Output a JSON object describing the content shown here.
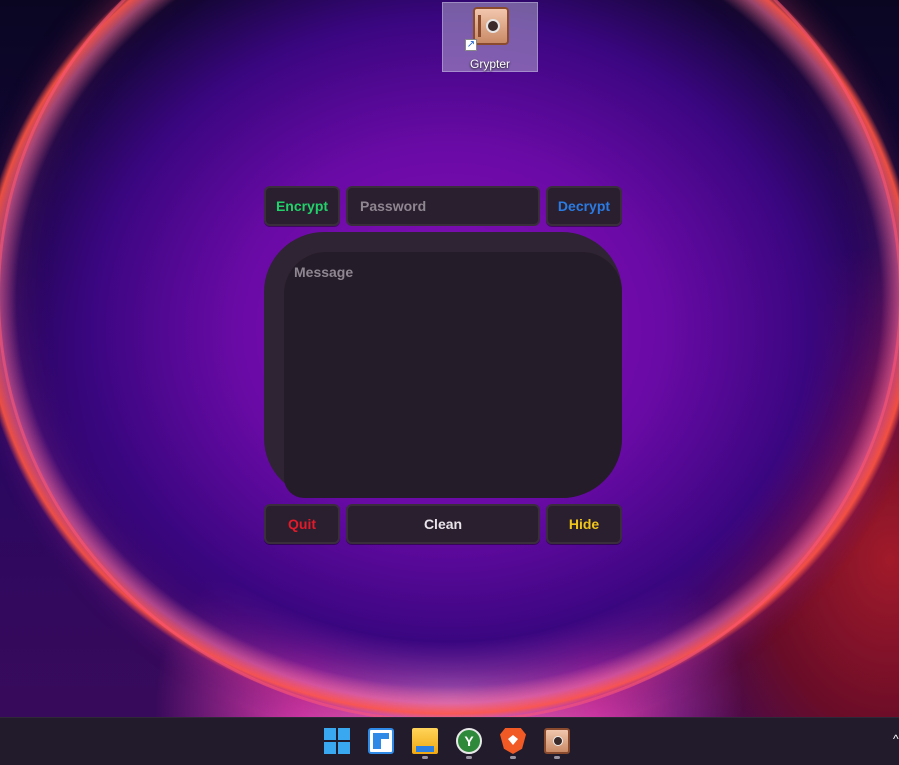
{
  "desktop": {
    "icon_label": "Grypter",
    "icon": "safe-icon"
  },
  "app": {
    "encrypt_label": "Encrypt",
    "decrypt_label": "Decrypt",
    "password_placeholder": "Password",
    "password_value": "",
    "message_placeholder": "Message",
    "message_value": "",
    "quit_label": "Quit",
    "clean_label": "Clean",
    "hide_label": "Hide",
    "colors": {
      "encrypt": "#22d16a",
      "decrypt": "#2a7be3",
      "quit": "#e21a2a",
      "hide": "#f0c51a",
      "clean": "#e8e4ea",
      "placeholder": "#8e8690"
    }
  },
  "taskbar": {
    "items": [
      {
        "name": "start",
        "icon": "windows-logo-icon"
      },
      {
        "name": "widgets",
        "icon": "widgets-icon"
      },
      {
        "name": "file-explorer",
        "icon": "folder-icon"
      },
      {
        "name": "app-green",
        "icon": "green-app-icon"
      },
      {
        "name": "brave",
        "icon": "brave-lion-icon"
      },
      {
        "name": "grypter",
        "icon": "safe-icon"
      }
    ],
    "tray_chevron": "^"
  }
}
